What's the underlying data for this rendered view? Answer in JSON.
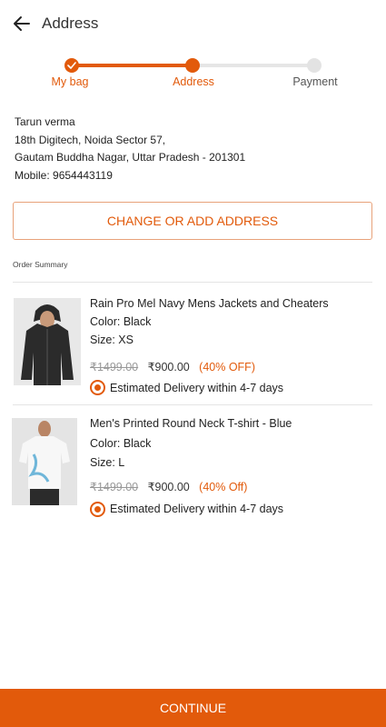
{
  "header": {
    "title": "Address"
  },
  "stepper": {
    "steps": [
      {
        "label": "My bag"
      },
      {
        "label": "Address"
      },
      {
        "label": "Payment"
      }
    ]
  },
  "address": {
    "name": "Tarun verma",
    "line1": "18th Digitech, Noida Sector 57,",
    "line2": "Gautam Buddha Nagar, Uttar Pradesh - 201301",
    "mobile": "Mobile: 9654443119"
  },
  "change_button_label": "CHANGE OR ADD ADDRESS",
  "order_summary_label": "Order Summary",
  "items": [
    {
      "name": "Rain Pro Mel Navy Mens Jackets and Cheaters",
      "color": "Color: Black",
      "size": "Size: XS",
      "mrp": "₹1499.00",
      "price": "₹900.00",
      "discount": "(40% OFF)",
      "delivery": "Estimated Delivery within 4-7 days",
      "image_icon": "jacket-image"
    },
    {
      "name": "Men's Printed Round Neck T-shirt - Blue",
      "color": "Color: Black",
      "size": "Size: L",
      "mrp": "₹1499.00",
      "price": "₹900.00",
      "discount": "(40% Off)",
      "delivery": "Estimated Delivery within 4-7 days",
      "image_icon": "tshirt-image"
    }
  ],
  "continue_label": "CONTINUE",
  "colors": {
    "accent": "#e25a0b",
    "inactive_step": "#e3e3e3"
  }
}
